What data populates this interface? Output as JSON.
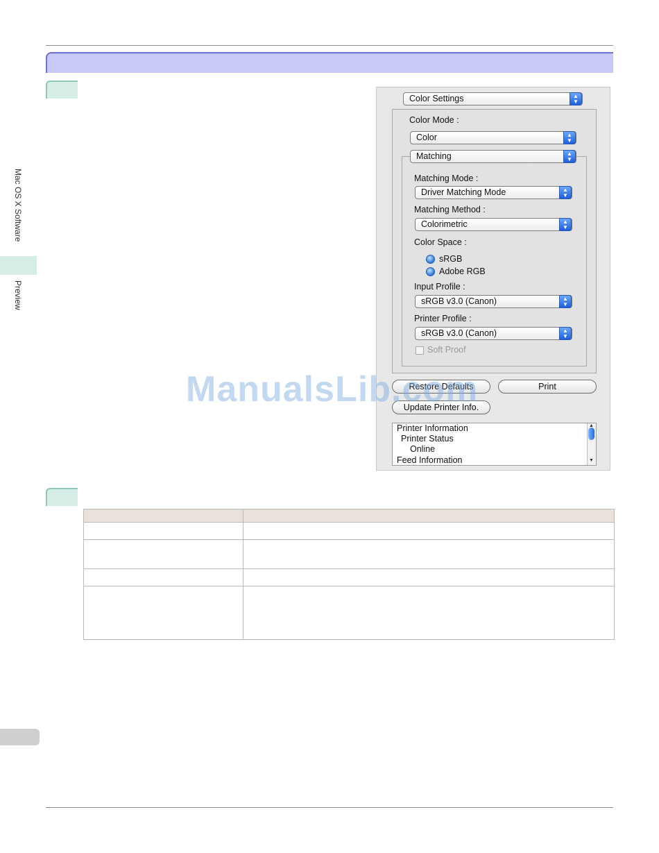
{
  "sidebar": {
    "section_label": "Mac OS X Software",
    "subsection_label": "Preview"
  },
  "dialog": {
    "top_popup": "Color Settings",
    "color_mode_label": "Color Mode :",
    "color_mode_value": "Color",
    "matching_popup": "Matching",
    "matching_mode_label": "Matching Mode :",
    "matching_mode_value": "Driver Matching Mode",
    "matching_method_label": "Matching Method :",
    "matching_method_value": "Colorimetric",
    "color_space_label": "Color Space :",
    "color_space_options": [
      "sRGB",
      "Adobe RGB"
    ],
    "input_profile_label": "Input Profile :",
    "input_profile_value": "sRGB v3.0 (Canon)",
    "printer_profile_label": "Printer Profile :",
    "printer_profile_value": "sRGB v3.0 (Canon)",
    "soft_proof_label": "Soft Proof",
    "restore_button": "Restore Defaults",
    "print_button": "Print",
    "update_button": "Update Printer Info.",
    "info_lines": [
      "Printer Information",
      "Printer Status",
      "Online",
      "Feed Information"
    ]
  },
  "watermark": "ManualsLib.com",
  "colors": {
    "heading_bar": "#c9c9f7",
    "heading_border": "#6b6fd6",
    "step_tab": "#d6ece6",
    "table_header": "#e8e2da"
  }
}
